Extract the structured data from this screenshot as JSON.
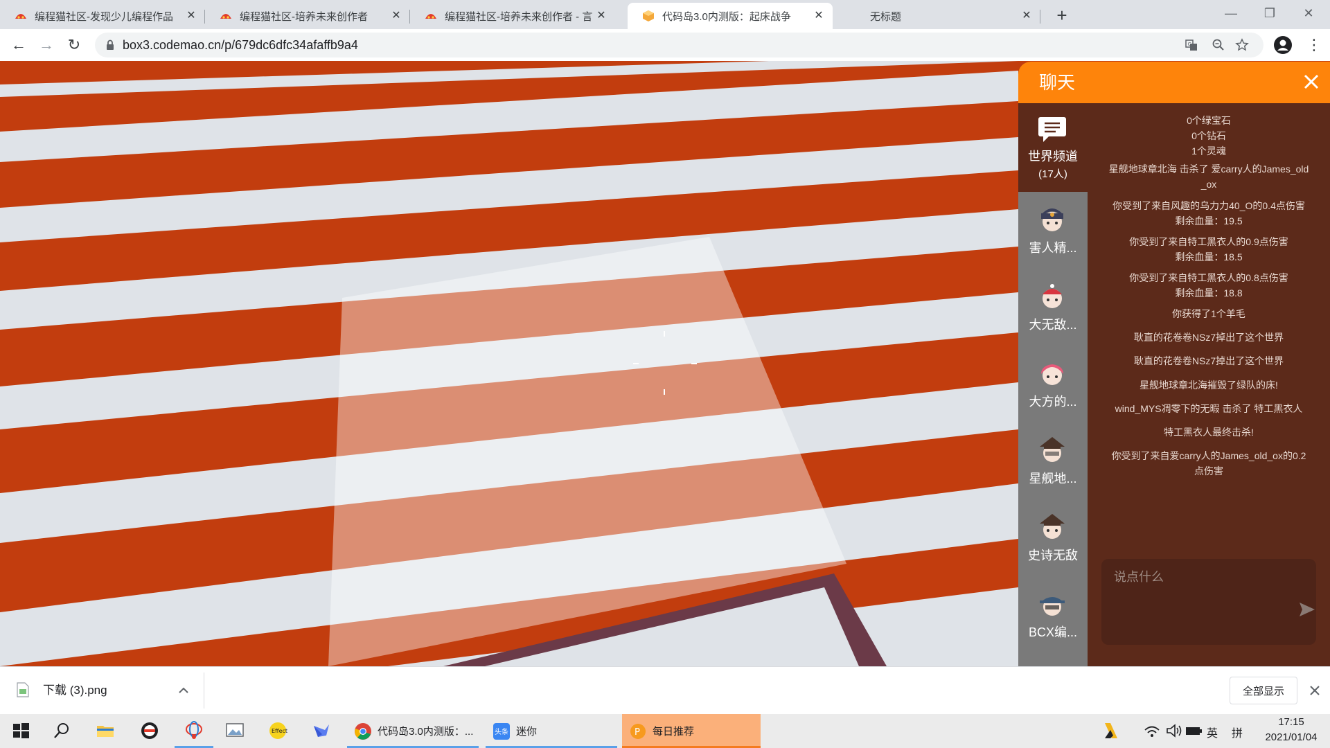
{
  "browser": {
    "tabs": [
      {
        "title": "编程猫社区-发现少儿编程作品",
        "active": false,
        "icon": "codemao-icon"
      },
      {
        "title": "编程猫社区-培养未来创作者",
        "active": false,
        "icon": "codemao-icon"
      },
      {
        "title": "编程猫社区-培养未来创作者 - 言",
        "active": false,
        "icon": "codemao-icon"
      },
      {
        "title": "代码岛3.0内测版：起床战争",
        "active": true,
        "icon": "box3-icon"
      },
      {
        "title": "无标题",
        "active": false,
        "icon": "none"
      }
    ],
    "new_tab_label": "+",
    "window_controls": {
      "minimize": "—",
      "maximize": "❐",
      "close": "✕"
    },
    "nav": {
      "back": "←",
      "forward": "→",
      "reload": "↻"
    },
    "url": "box3.codemao.cn/p/679dc6dfc34afaffb9a4",
    "menu_label": "⋮"
  },
  "chat": {
    "title": "聊天",
    "world_channel": {
      "label": "世界频道",
      "count": "(17人)"
    },
    "users": [
      {
        "name": "害人精...",
        "avatar_color": "#3b3f5a"
      },
      {
        "name": "大无敌...",
        "avatar_color": "#d8353f"
      },
      {
        "name": "大方的...",
        "avatar_color": "#e85a7a"
      },
      {
        "name": "星舰地...",
        "avatar_color": "#4a3328"
      },
      {
        "name": "史诗无敌",
        "avatar_color": "#4a3328"
      },
      {
        "name": "BCX编...",
        "avatar_color": "#3c5a7a"
      }
    ],
    "messages": [
      {
        "lines": [
          "0个绿宝石",
          "0个钻石",
          "1个灵魂"
        ]
      },
      {
        "lines": [
          "星舰地球章北海 击杀了 爱carry人的James_old",
          "_ox"
        ]
      },
      {
        "lines": [
          "你受到了来自风趣的乌力力40_O的0.4点伤害",
          "剩余血量：19.5"
        ]
      },
      {
        "lines": [
          "你受到了来自特工黑衣人的0.9点伤害",
          "剩余血量：18.5"
        ]
      },
      {
        "lines": [
          "你受到了来自特工黑衣人的0.8点伤害",
          "剩余血量：18.8"
        ]
      },
      {
        "lines": [
          "你获得了1个羊毛"
        ]
      },
      {
        "lines": [
          "耿直的花卷卷NSz7掉出了这个世界"
        ]
      },
      {
        "lines": [
          "耿直的花卷卷NSz7掉出了这个世界"
        ]
      },
      {
        "lines": [
          "星舰地球章北海摧毁了绿队的床!"
        ]
      },
      {
        "lines": [
          "wind_MYS凋零下的无暇 击杀了 特工黑衣人"
        ]
      },
      {
        "lines": [
          "特工黑衣人最终击杀!"
        ]
      },
      {
        "lines": [
          "你受到了来自爱carry人的James_old_ox的0.2",
          "点伤害"
        ]
      }
    ],
    "input_placeholder": "说点什么"
  },
  "downloads": {
    "file_name": "下载 (3).png",
    "show_all_label": "全部显示"
  },
  "taskbar": {
    "apps": [
      {
        "label": "代码岛3.0内测版：...",
        "icon": "chrome-icon"
      },
      {
        "label": "迷你",
        "icon": "toutiao-icon"
      },
      {
        "label": "每日推荐",
        "icon": "recommend-icon"
      }
    ],
    "ime_lang": "英",
    "ime_mode": "拼",
    "clock_time": "17:15",
    "clock_date": "2021/01/04"
  },
  "colors": {
    "accent_orange": "#fe840b",
    "chat_bg": "#5c2a1a",
    "game_orange": "#c23d0e",
    "stripe_white": "#dfe3e8"
  }
}
